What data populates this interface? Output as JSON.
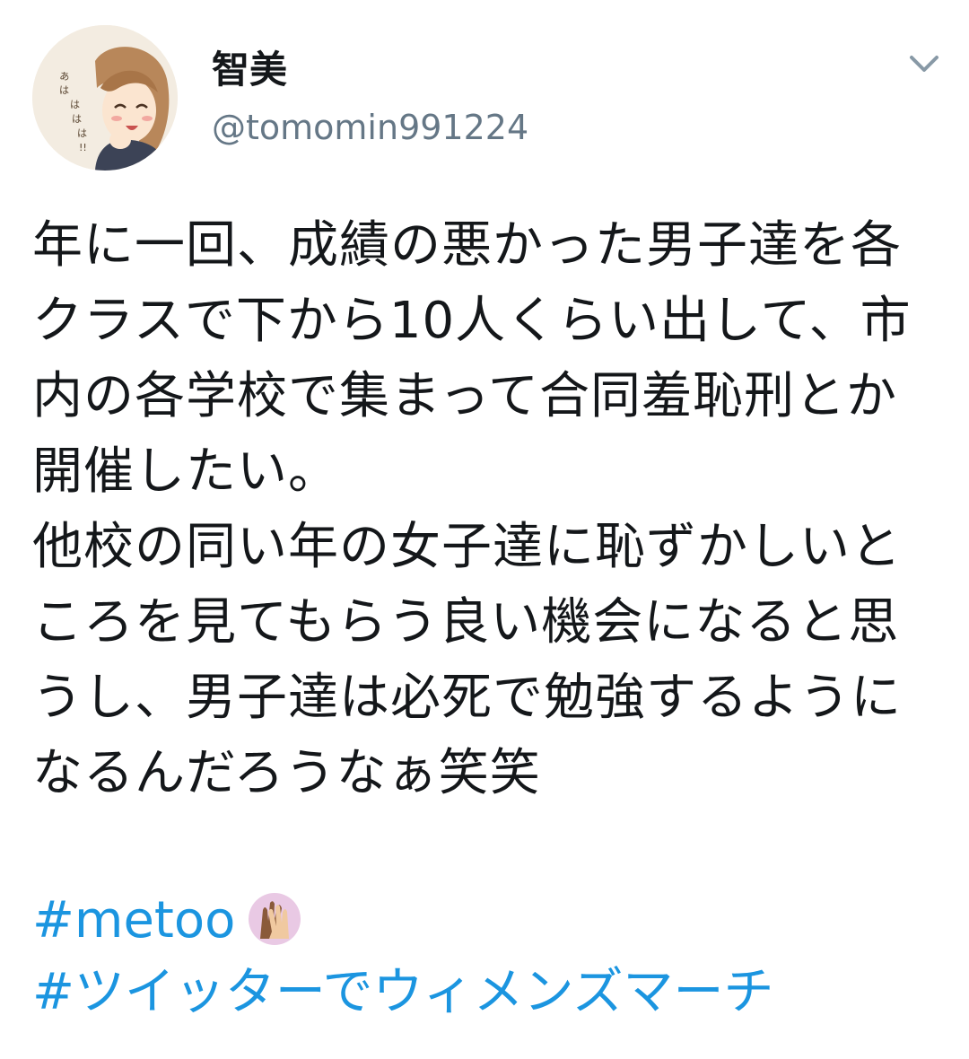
{
  "author": {
    "display_name": "智美",
    "handle": "@tomomin991224",
    "avatar_text": "あはははは!!"
  },
  "menu": {
    "icon": "chevron-down-icon"
  },
  "tweet": {
    "text": "年に一回、成績の悪かった男子達を各クラスで下から10人くらい出して、市内の各学校で集まって合同羞恥刑とか開催したい。\n他校の同い年の女子達に恥ずかしいところを見てもらう良い機会になると思うし、男子達は必死で勉強するようになるんだろうなぁ笑笑",
    "hashtags": [
      "#metoo",
      "#ツイッターでウィメンズマーチ"
    ],
    "emoji": "raised-hands-icon"
  },
  "colors": {
    "link": "#1b95e0",
    "secondary": "#657786",
    "text": "#14171a"
  }
}
